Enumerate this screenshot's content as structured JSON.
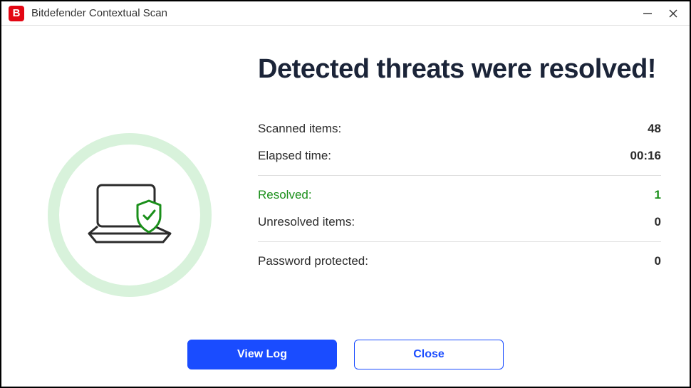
{
  "window": {
    "title": "Bitdefender Contextual Scan",
    "app_letter": "B"
  },
  "headline": "Detected threats were resolved!",
  "stats": {
    "scanned_label": "Scanned items:",
    "scanned_value": "48",
    "elapsed_label": "Elapsed time:",
    "elapsed_value": "00:16",
    "resolved_label": "Resolved:",
    "resolved_value": "1",
    "unresolved_label": "Unresolved items:",
    "unresolved_value": "0",
    "password_label": "Password protected:",
    "password_value": "0"
  },
  "buttons": {
    "view_log": "View Log",
    "close": "Close"
  },
  "colors": {
    "accent": "#1a4cff",
    "success": "#1a8f1a",
    "brand": "#e30613"
  }
}
